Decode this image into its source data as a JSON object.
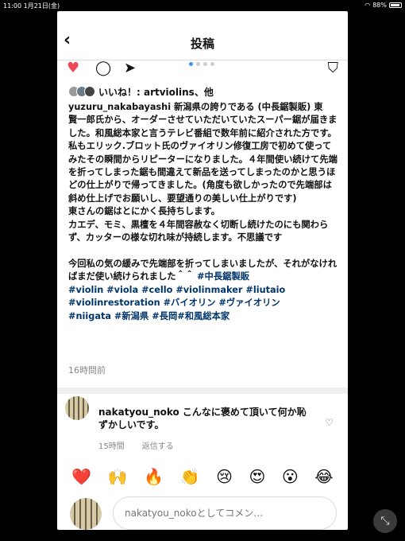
{
  "status_bar": {
    "time": "11:00",
    "date": "1月21日(金)",
    "battery": "88%"
  },
  "header": {
    "title": "投稿"
  },
  "likes": {
    "text": "いいね！: artviolins、他"
  },
  "post": {
    "username": "yuzuru_nakabayashi",
    "caption": " 新潟県の誇りである (中長鋸製販) 東　賢一郎氏から、オーダーさせていただいていたスーパー鋸が届きました。和風総本家と言うテレビ番組で数年前に紹介された方です。私もエリック.ブロット氏のヴァイオリン修復工房で初めて使ってみたその瞬間からリピーターになりました。４年間使い続けて先端を折ってしまった鋸も間違えて新品を送ってしまったのかと思うほどの仕上がりで帰ってきました。(角度も欲しかったので先端部は斜め仕上げでお願いし、要望通りの美しい仕上がりです)\n東さんの鋸はとにかく長持ちします。\nカエデ、モミ、黒檀を４年間容赦なく切断し続けたのにも関わらず、カッターの様な切れ味が持続します。不思議です\n\n今回私の気の緩みで先端部を折ってしまいましたが、それがなければまだ使い続けられました＾＾ ",
    "hashtags": "#中長鋸製販\n#violin #viola #cello #violinmaker #liutaio\n#violinrestoration #バイオリン #ヴァイオリン\n#niigata #新潟県 #長岡#和風総本家",
    "time_ago": "16時間前"
  },
  "comment": {
    "text": "nakatyou_noko こんなに褒めて頂いて何か恥ずかしいです。",
    "time_ago": "15時間",
    "reply": "返信する"
  },
  "emoji_bar": [
    "❤️",
    "🙌",
    "🔥",
    "👏",
    "😢",
    "😍",
    "😮",
    "😂"
  ],
  "input": {
    "placeholder": "nakatyou_nokoとしてコメン…"
  }
}
